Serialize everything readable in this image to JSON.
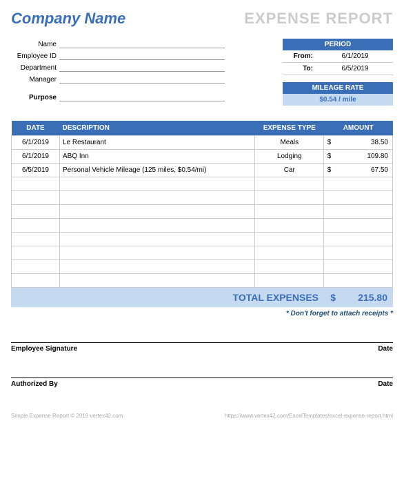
{
  "header": {
    "company": "Company Name",
    "title": "EXPENSE REPORT"
  },
  "fields": {
    "name_label": "Name",
    "employee_id_label": "Employee ID",
    "department_label": "Department",
    "manager_label": "Manager",
    "purpose_label": "Purpose"
  },
  "period": {
    "header": "PERIOD",
    "from_label": "From:",
    "from_value": "6/1/2019",
    "to_label": "To:",
    "to_value": "6/5/2019"
  },
  "mileage": {
    "header": "MILEAGE RATE",
    "value": "$0.54 / mile"
  },
  "table": {
    "headers": {
      "date": "DATE",
      "description": "DESCRIPTION",
      "expense_type": "EXPENSE TYPE",
      "amount": "AMOUNT"
    },
    "rows": [
      {
        "date": "6/1/2019",
        "description": "Le Restaurant",
        "type": "Meals",
        "cur": "$",
        "amount": "38.50"
      },
      {
        "date": "6/1/2019",
        "description": "ABQ Inn",
        "type": "Lodging",
        "cur": "$",
        "amount": "109.80"
      },
      {
        "date": "6/5/2019",
        "description": "Personal Vehicle Mileage (125 miles, $0.54/mi)",
        "type": "Car",
        "cur": "$",
        "amount": "67.50"
      }
    ]
  },
  "total": {
    "label": "TOTAL EXPENSES",
    "cur": "$",
    "value": "215.80"
  },
  "reminder": "* Don't forget to attach receipts *",
  "signatures": {
    "employee": "Employee Signature",
    "authorized": "Authorized By",
    "date": "Date"
  },
  "footer": {
    "left": "Simple Expense Report © 2019 vertex42.com",
    "right": "https://www.vertex42.com/ExcelTemplates/excel-expense-report.html"
  }
}
